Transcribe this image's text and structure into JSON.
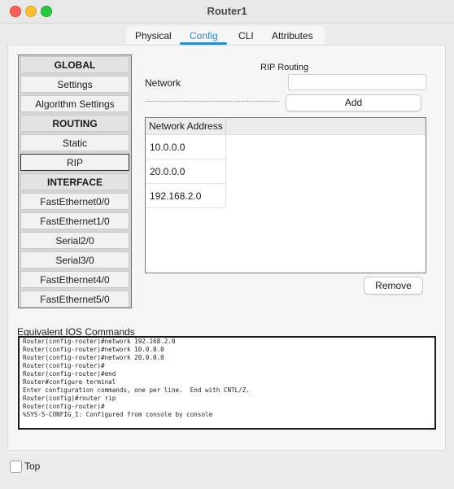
{
  "window": {
    "title": "Router1"
  },
  "tabs": [
    {
      "label": "Physical",
      "active": false
    },
    {
      "label": "Config",
      "active": true
    },
    {
      "label": "CLI",
      "active": false
    },
    {
      "label": "Attributes",
      "active": false
    }
  ],
  "nav": [
    {
      "label": "GLOBAL",
      "header": true
    },
    {
      "label": "Settings"
    },
    {
      "label": "Algorithm Settings"
    },
    {
      "label": "ROUTING",
      "header": true
    },
    {
      "label": "Static"
    },
    {
      "label": "RIP",
      "selected": true
    },
    {
      "label": "INTERFACE",
      "header": true
    },
    {
      "label": "FastEthernet0/0"
    },
    {
      "label": "FastEthernet1/0"
    },
    {
      "label": "Serial2/0"
    },
    {
      "label": "Serial3/0"
    },
    {
      "label": "FastEthernet4/0"
    },
    {
      "label": "FastEthernet5/0"
    }
  ],
  "rip": {
    "title": "RIP Routing",
    "network_label": "Network",
    "network_value": "",
    "add_label": "Add",
    "remove_label": "Remove",
    "table": {
      "header": "Network Address",
      "rows": [
        "10.0.0.0",
        "20.0.0.0",
        "192.168.2.0"
      ]
    }
  },
  "ios": {
    "label": "Equivalent IOS Commands",
    "lines": [
      "Router(config-router)#network 192.168.2.0",
      "Router(config-router)#network 10.0.0.0",
      "Router(config-router)#network 20.0.0.0",
      "Router(config-router)#",
      "Router(config-router)#end",
      "Router#configure terminal",
      "Enter configuration commands, one per line.  End with CNTL/Z.",
      "Router(config)#router rip",
      "Router(config-router)#",
      "%SYS-5-CONFIG_I: Configured from console by console"
    ]
  },
  "footer": {
    "top_label": "Top",
    "top_checked": false
  },
  "colors": {
    "accent": "#2a8bd0"
  }
}
